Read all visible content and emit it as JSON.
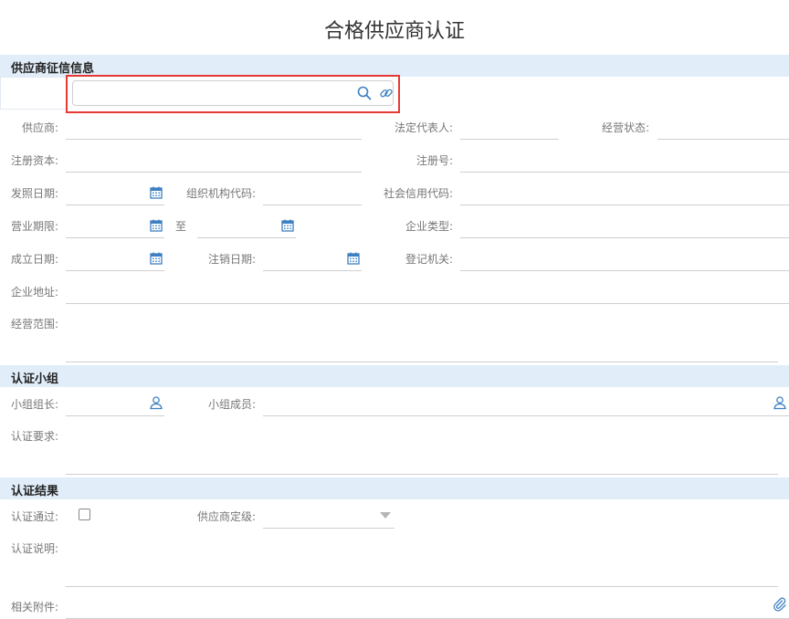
{
  "page": {
    "title": "合格供应商认证"
  },
  "sections": {
    "supplier_info": "供应商征信信息",
    "team": "认证小组",
    "result": "认证结果"
  },
  "search": {
    "value": "",
    "placeholder": ""
  },
  "labels": {
    "supplier": "供应商:",
    "legal_rep": "法定代表人:",
    "biz_status": "经营状态:",
    "reg_capital": "注册资本:",
    "reg_no": "注册号:",
    "license_date": "发照日期:",
    "org_code": "组织机构代码:",
    "credit_code": "社会信用代码:",
    "biz_term": "营业期限:",
    "to": "至",
    "company_type": "企业类型:",
    "est_date": "成立日期:",
    "cancel_date": "注销日期:",
    "reg_authority": "登记机关:",
    "address": "企业地址:",
    "biz_scope": "经营范围:",
    "team_leader": "小组组长:",
    "team_members": "小组成员:",
    "cert_req": "认证要求:",
    "cert_passed": "认证通过:",
    "supplier_grade": "供应商定级:",
    "cert_note": "认证说明:",
    "attachments": "相关附件:"
  },
  "values": {
    "supplier_grade": ""
  },
  "icons": {
    "search": "search-icon",
    "link": "link-icon",
    "calendar": "calendar-icon",
    "user": "user-icon",
    "paperclip": "paperclip-icon"
  },
  "colors": {
    "section_bg": "#e1edf9",
    "icon_blue": "#3d7fc1",
    "highlight": "#e53935"
  }
}
